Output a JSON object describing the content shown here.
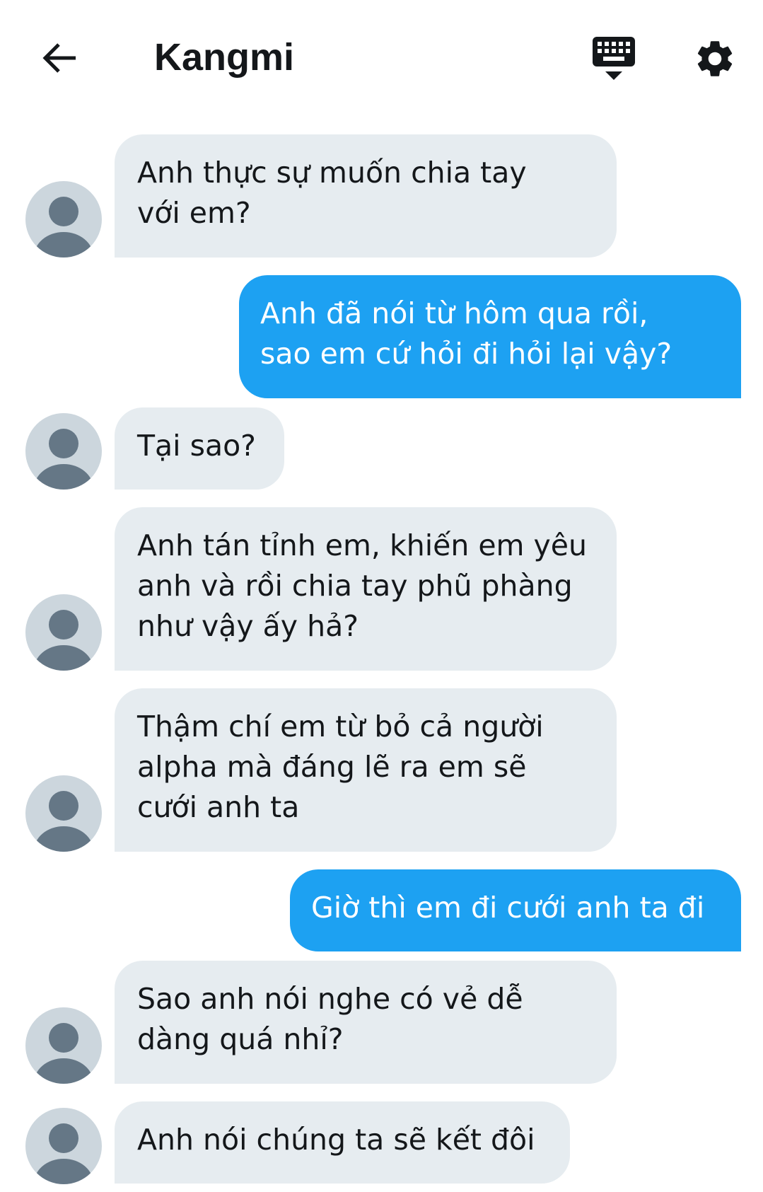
{
  "header": {
    "back_icon": "arrow-left-icon",
    "title": "Kangmi",
    "keyboard_icon": "keyboard-hide-icon",
    "settings_icon": "gear-icon"
  },
  "colors": {
    "incoming_bubble": "#e6ecf0",
    "outgoing_bubble": "#1da1f2",
    "avatar_bg": "#ccd6dd",
    "avatar_figure": "#657786",
    "text": "#14171a"
  },
  "messages": [
    {
      "direction": "incoming",
      "text": "Anh thực sự muốn chia tay\nvới em?"
    },
    {
      "direction": "outgoing",
      "text": "Anh đã nói từ hôm qua rồi,\nsao em cứ hỏi đi hỏi lại vậy?"
    },
    {
      "direction": "incoming",
      "text": "Tại sao?"
    },
    {
      "direction": "incoming",
      "text": "Anh tán tỉnh em, khiến em yêu\nanh và rồi chia tay phũ phàng\nnhư vậy ấy hả?"
    },
    {
      "direction": "incoming",
      "text": "Thậm chí em từ bỏ cả người\nalpha mà đáng lẽ ra em sẽ\ncưới anh ta"
    },
    {
      "direction": "outgoing",
      "text": "Giờ thì em đi cưới anh ta đi"
    },
    {
      "direction": "incoming",
      "text": "Sao anh nói nghe có vẻ dễ\ndàng quá nhỉ?"
    },
    {
      "direction": "incoming",
      "text": "Anh nói chúng ta sẽ kết đôi"
    }
  ]
}
